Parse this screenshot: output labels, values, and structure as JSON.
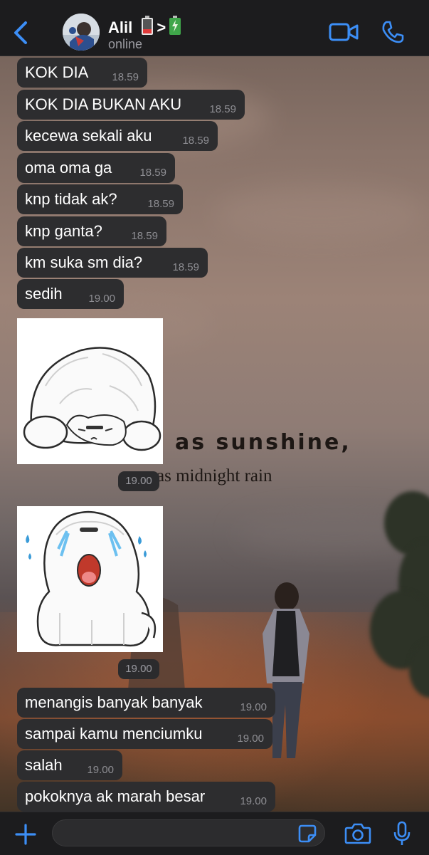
{
  "header": {
    "contact_name": "Alil",
    "name_separator": ">",
    "status": "online"
  },
  "wallpaper": {
    "quote_line1": "as sunshine,",
    "quote_line2": "as midnight rain"
  },
  "messages": [
    {
      "text": "KOK DIA",
      "time": "18.59"
    },
    {
      "text": "KOK DIA BUKAN AKU",
      "time": "18.59"
    },
    {
      "text": "kecewa sekali aku",
      "time": "18.59"
    },
    {
      "text": "oma oma ga",
      "time": "18.59"
    },
    {
      "text": "knp tidak ak?",
      "time": "18.59"
    },
    {
      "text": "knp ganta?",
      "time": "18.59"
    },
    {
      "text": "km suka sm dia?",
      "time": "18.59"
    },
    {
      "text": "sedih",
      "time": "19.00"
    }
  ],
  "stickers": [
    {
      "name": "sad-dog-sticker",
      "time": "19.00"
    },
    {
      "name": "crying-dog-sticker",
      "time": "19.00"
    }
  ],
  "messages_after": [
    {
      "text": "menangis banyak banyak",
      "time": "19.00"
    },
    {
      "text": "sampai kamu menciumku",
      "time": "19.00"
    },
    {
      "text": "salah",
      "time": "19.00"
    },
    {
      "text": "pokoknya ak marah besar",
      "time": "19.00"
    }
  ],
  "composer": {
    "value": ""
  },
  "colors": {
    "accent": "#3c8ef6",
    "bubble": "#2d2d2f",
    "bar": "#1c1c1e"
  }
}
